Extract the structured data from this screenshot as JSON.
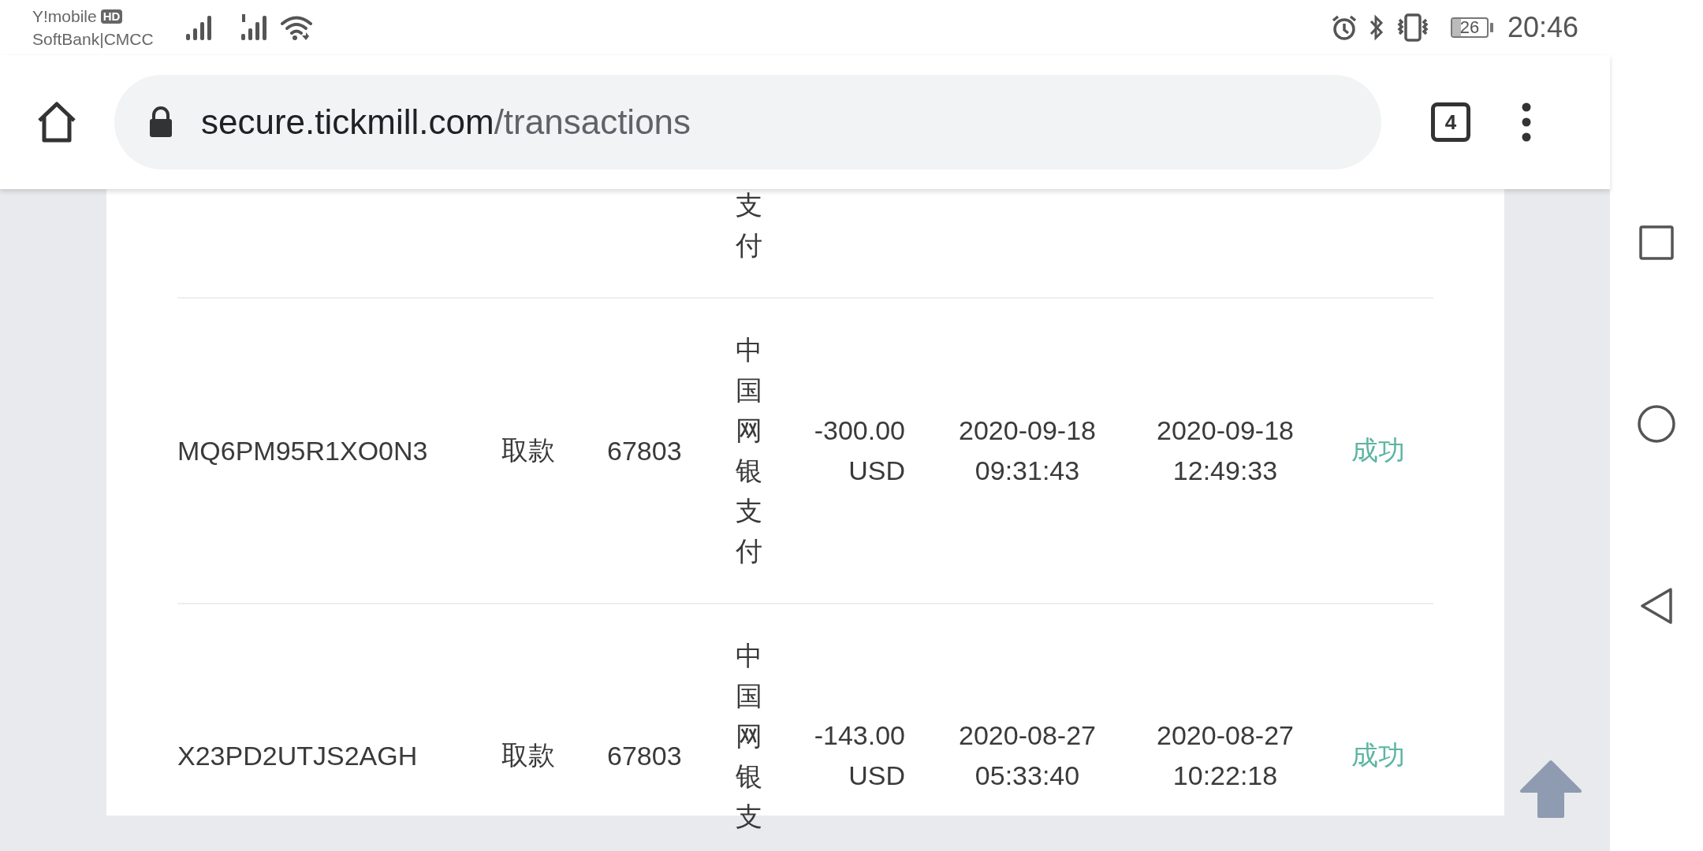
{
  "status_bar": {
    "carrier_1": "Y!mobile",
    "carrier_1_badge": "HD",
    "carrier_2": "SoftBank|CMCC",
    "battery": "26",
    "time": "20:46"
  },
  "browser": {
    "url_host": "secure.tickmill.com",
    "url_path": "/transactions",
    "tab_count": "4"
  },
  "table": {
    "rows": [
      {
        "column_4": "支付"
      },
      {
        "column_1": "MQ6PM95R1XO0N3",
        "column_2": "取款",
        "column_3": "67803",
        "column_4": "中国网银支付",
        "column_5": "-300.00 USD",
        "column_6": "2020-09-18 09:31:43",
        "column_7": "2020-09-18 12:49:33",
        "column_8": "成功"
      },
      {
        "column_1": "X23PD2UTJS2AGH",
        "column_2": "取款",
        "column_3": "67803",
        "column_4": "中国网银支",
        "column_5": "-143.00 USD",
        "column_6": "2020-08-27 05:33:40",
        "column_7": "2020-08-27 10:22:18",
        "column_8": "成功"
      }
    ]
  }
}
